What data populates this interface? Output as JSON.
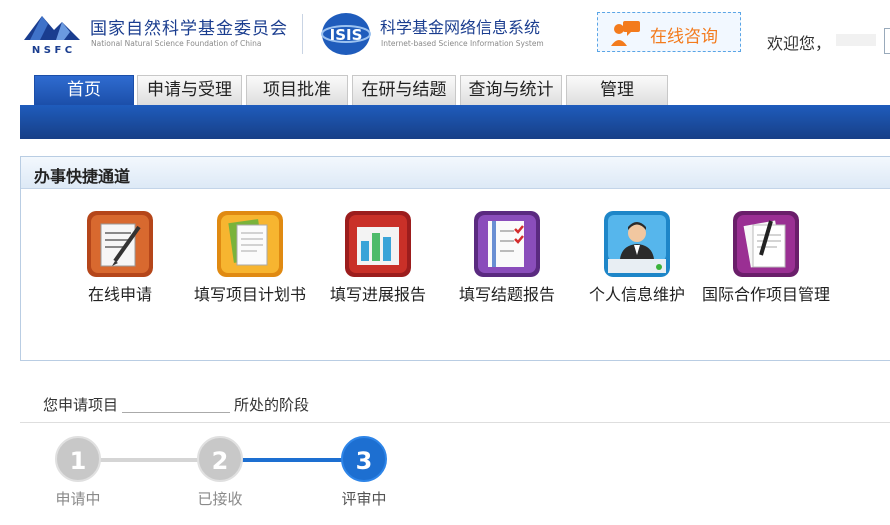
{
  "header": {
    "org_cn": "国家自然科学基金委员会",
    "org_en": "National Natural Science Foundation of China",
    "logo_text": "N S F C",
    "system_logo_text": "ISIS",
    "system_cn": "科学基金网络信息系统",
    "system_en": "Internet-based Science Information System",
    "consult_label": "在线咨询",
    "welcome": "欢迎您，"
  },
  "nav": {
    "tabs": [
      {
        "label": "首页",
        "active": true
      },
      {
        "label": "申请与受理",
        "active": false
      },
      {
        "label": "项目批准",
        "active": false
      },
      {
        "label": "在研与结题",
        "active": false
      },
      {
        "label": "查询与统计",
        "active": false
      },
      {
        "label": "管理",
        "active": false
      }
    ]
  },
  "quick_access": {
    "title": "办事快捷通道",
    "items": [
      {
        "label": "在线申请",
        "icon": "online-apply-icon"
      },
      {
        "label": "填写项目计划书",
        "icon": "project-plan-icon"
      },
      {
        "label": "填写进展报告",
        "icon": "progress-report-icon"
      },
      {
        "label": "填写结题报告",
        "icon": "final-report-icon"
      },
      {
        "label": "个人信息维护",
        "icon": "personal-info-icon"
      },
      {
        "label": "国际合作项目管理",
        "icon": "intl-cooperation-icon"
      }
    ]
  },
  "stage": {
    "prefix": "您申请项目",
    "suffix": "所处的阶段",
    "steps": [
      {
        "num": "1",
        "label": "申请中",
        "state": "done"
      },
      {
        "num": "2",
        "label": "已接收",
        "state": "done"
      },
      {
        "num": "3",
        "label": "评审中",
        "state": "current"
      }
    ]
  },
  "colors": {
    "nav_bar": "#1f5cbc",
    "brand_blue": "#1a3d8f",
    "consult_orange": "#f37b1d",
    "step_current": "#1d6fd1",
    "step_done": "#c8c8c8"
  }
}
